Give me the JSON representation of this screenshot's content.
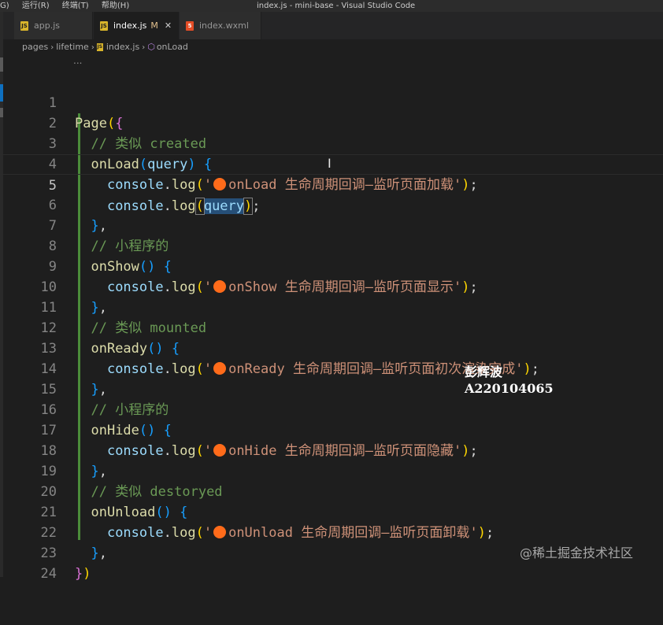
{
  "window": {
    "title": "index.js - mini-base - Visual Studio Code",
    "menu": [
      "G)",
      "运行(R)",
      "终端(T)",
      "帮助(H)"
    ]
  },
  "tabs": [
    {
      "label": "app.js",
      "icon": "js-file-icon",
      "active": false,
      "modified": ""
    },
    {
      "label": "index.js",
      "icon": "js-file-icon",
      "active": true,
      "modified": "M"
    },
    {
      "label": "index.wxml",
      "icon": "html5-file-icon",
      "active": false,
      "modified": ""
    }
  ],
  "breadcrumb": {
    "items": [
      "pages",
      "lifetime",
      "index.js",
      "onLoad"
    ],
    "method_icon": "method-cube-icon"
  },
  "editor": {
    "fold_marker": "...",
    "current_line": 5,
    "line_numbers": [
      "1",
      "2",
      "3",
      "4",
      "5",
      "6",
      "7",
      "8",
      "9",
      "10",
      "11",
      "12",
      "13",
      "14",
      "15",
      "16",
      "17",
      "18",
      "19",
      "20",
      "21",
      "22",
      "23",
      "24"
    ],
    "strings": {
      "l4": "onLoad 生命周期回调—监听页面加载",
      "l9": "onShow 生命周期回调—监听页面显示",
      "l13": "onReady 生命周期回调—监听页面初次渲染完成",
      "l17": "onHide 生命周期回调—监听页面隐藏",
      "l21": "onUnload 生命周期回调—监听页面卸载"
    },
    "comments": {
      "l2": "// 类似 created",
      "l7": "// 小程序的",
      "l11": "// 类似 mounted",
      "l15": "// 小程序的",
      "l19": "// 类似 destoryed"
    },
    "tokens": {
      "page": "Page",
      "onLoad": "onLoad",
      "onShow": "onShow",
      "onReady": "onReady",
      "onHide": "onHide",
      "onUnload": "onUnload",
      "console": "console",
      "log": "log",
      "query": "query"
    }
  },
  "overlay": {
    "author_name": "彭辉波",
    "author_id": "A220104065",
    "watermark": "@稀土掘金技术社区"
  },
  "colors": {
    "editor_bg": "#1e1e1e",
    "function": "#dcdcaa",
    "variable": "#9cdcfe",
    "string": "#ce9178",
    "comment": "#6a9955",
    "bracket_1": "#ffd700",
    "bracket_2": "#da70d6",
    "bracket_3": "#179fff",
    "emoji_orange": "#ff6b1a"
  }
}
